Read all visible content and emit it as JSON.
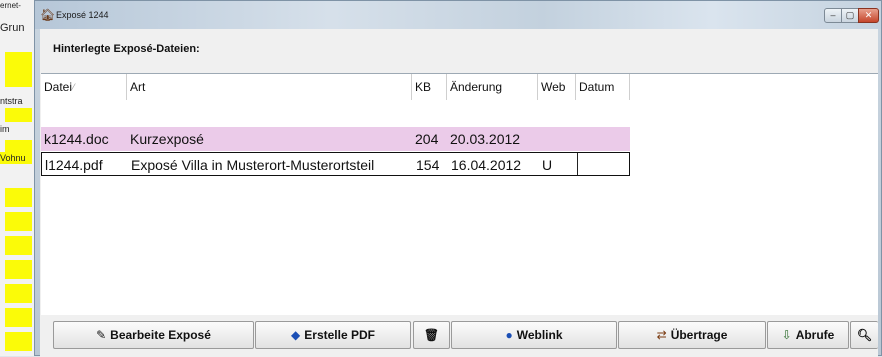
{
  "background_app": {
    "labels": [
      "ernet-",
      "Grun",
      "ntstra",
      "im",
      "Vohnu"
    ]
  },
  "window": {
    "title": "Exposé 1244",
    "controls": {
      "minimize": "–",
      "maximize": "▢",
      "close": "✕"
    }
  },
  "section": {
    "heading": "Hinterlegte Exposé-Dateien:"
  },
  "table": {
    "columns": [
      "Datei",
      "Art",
      "KB",
      "Änderung",
      "Web",
      "Datum"
    ],
    "sort_mark": "⁄",
    "rows": [
      {
        "datei": "k1244.doc",
        "art": "Kurzexposé",
        "kb": "204",
        "aenderung": "20.03.2012",
        "web": "",
        "datum": ""
      },
      {
        "datei": "l1244.pdf",
        "art": "Exposé Villa in Musterort-Musterortsteil",
        "kb": "154",
        "aenderung": "16.04.2012",
        "web": "U",
        "datum": ""
      }
    ]
  },
  "toolbar": {
    "edit_label": "Bearbeite Exposé",
    "pdf_label": "Erstelle PDF",
    "delete_label": "",
    "weblink_label": "Weblink",
    "transfer_label": "Übertrage",
    "fetch_label": "Abrufe",
    "zoom_label": ""
  },
  "icons": {
    "window_icon": "house-icon",
    "edit": "pencil-icon",
    "pdf": "pdf-icon",
    "delete": "trash-icon",
    "weblink": "globe-icon",
    "transfer": "transfer-icon",
    "fetch": "fetch-icon",
    "zoom": "magnifier-icon"
  },
  "colors": {
    "highlight_row": "#ebcbe9",
    "background_yellow": "#fbfb08",
    "close_button": "#c5452b"
  }
}
